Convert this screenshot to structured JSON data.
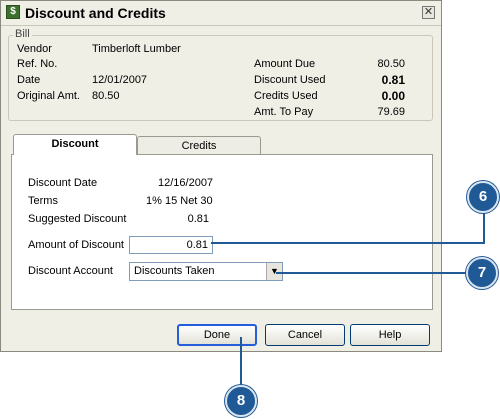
{
  "dialog": {
    "title": "Discount and Credits",
    "close_glyph": "✕"
  },
  "bill": {
    "legend": "Bill",
    "vendor_label": "Vendor",
    "vendor_value": "Timberloft Lumber",
    "ref_label": "Ref. No.",
    "ref_value": "",
    "date_label": "Date",
    "date_value": "12/01/2007",
    "orig_label": "Original Amt.",
    "orig_value": "80.50",
    "amount_due_label": "Amount Due",
    "amount_due_value": "80.50",
    "discount_used_label": "Discount Used",
    "discount_used_value": "0.81",
    "credits_used_label": "Credits Used",
    "credits_used_value": "0.00",
    "amt_to_pay_label": "Amt. To Pay",
    "amt_to_pay_value": "79.69"
  },
  "tabs": [
    {
      "label": "Discount",
      "active": true
    },
    {
      "label": "Credits",
      "active": false
    }
  ],
  "discount": {
    "date_label": "Discount Date",
    "date_value": "12/16/2007",
    "terms_label": "Terms",
    "terms_value": "1% 15 Net 30",
    "suggested_label": "Suggested Discount",
    "suggested_value": "0.81",
    "amount_label": "Amount of Discount",
    "amount_value": "0.81",
    "account_label": "Discount Account",
    "account_value": "Discounts Taken"
  },
  "buttons": {
    "done": "Done",
    "cancel": "Cancel",
    "help": "Help"
  },
  "callouts": {
    "c6": "6",
    "c7": "7",
    "c8": "8"
  },
  "colors": {
    "callout": "#1f5a96",
    "dialog_bg": "#f0efe6"
  }
}
